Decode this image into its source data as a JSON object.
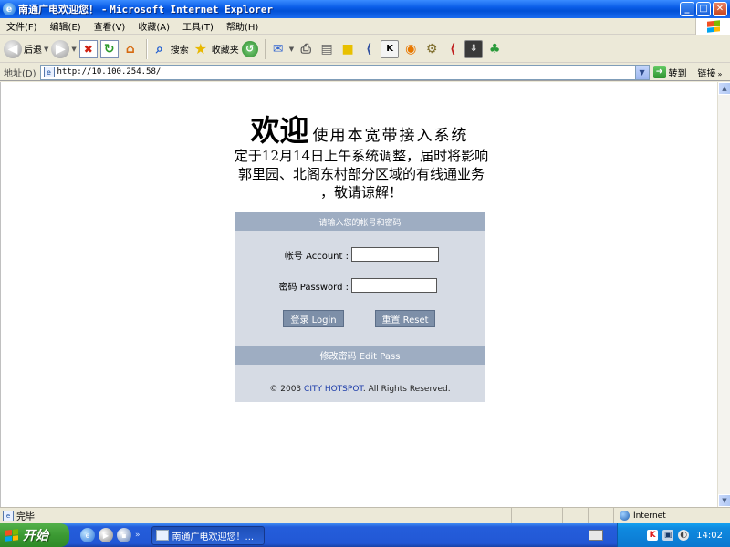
{
  "window": {
    "title_cn": "南通广电欢迎您！",
    "title_sep": " - ",
    "title_app": "Microsoft Internet Explorer",
    "min_glyph": "_",
    "max_glyph": "□",
    "close_glyph": "✕"
  },
  "menu": {
    "items": [
      "文件(F)",
      "编辑(E)",
      "查看(V)",
      "收藏(A)",
      "工具(T)",
      "帮助(H)"
    ]
  },
  "toolbar": {
    "back_label": "后退",
    "search_label": "搜索",
    "favorites_label": "收藏夹"
  },
  "address": {
    "label": "地址(D)",
    "url": "http://10.100.254.58/",
    "go_label": "转到",
    "links_label": "链接"
  },
  "page": {
    "welcome_big": "欢迎",
    "welcome_small": "使用本宽带接入系统",
    "notice": "定于12月14日上午系统调整，届时将影响郭里园、北阁东村部分区域的有线通业务 ，敬请谅解！",
    "panel_header": "请输入您的帐号和密码",
    "account_label": "帐号 Account :",
    "account_value": "",
    "password_label": "密码 Password :",
    "password_value": "",
    "login_button": "登录 Login",
    "reset_button": "重置 Reset",
    "edit_pass": "修改密码 Edit Pass",
    "copyright_prefix": "© 2003 ",
    "copyright_brand": "CITY HOTSPOT",
    "copyright_suffix": ". All Rights Reserved."
  },
  "status": {
    "text": "完毕",
    "zone": "Internet"
  },
  "taskbar": {
    "start_label": "开始",
    "task_label": "南通广电欢迎您！...",
    "clock": "14:02"
  },
  "colors": {
    "panel_bg": "#d6dbe4",
    "panel_header": "#9eadc2",
    "button_bg": "#7d8fa8",
    "brand_link": "#1a3aa8"
  },
  "icons": {
    "back": "back-arrow-icon",
    "forward": "forward-arrow-icon",
    "stop": "stop-icon",
    "refresh": "refresh-icon",
    "home": "home-icon",
    "search": "search-icon",
    "favorites": "star-icon",
    "history": "history-icon"
  }
}
